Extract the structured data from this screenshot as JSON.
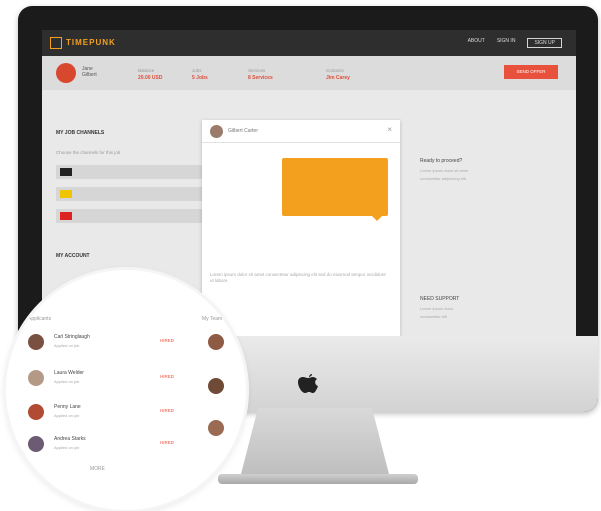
{
  "app": {
    "name": "TIMEPUNK"
  },
  "nav": {
    "item1": "ABOUT",
    "item2": "SIGN IN",
    "item3": "SIGN UP"
  },
  "profile": {
    "name_line1": "Jane",
    "name_line2": "Gilbert",
    "stats": [
      {
        "label": "Balance",
        "value": "20.00 USD"
      },
      {
        "label": "Jobs",
        "value": "5 Jobs"
      },
      {
        "label": "Services",
        "value": "8 Services"
      },
      {
        "label": "Contacts",
        "value": "Jim Carey"
      }
    ],
    "cta_label": "SEND OFFER"
  },
  "left": {
    "title": "MY JOB CHANNELS",
    "subtitle": "Choose the channels for this job",
    "section2": "MY ACCOUNT"
  },
  "modal": {
    "sender": "Gilbert Carter",
    "close": "×",
    "footer_text": "Lorem ipsum dolor sit amet consectetur adipiscing elit sed do eiusmod tempor incididunt ut labore"
  },
  "right": {
    "title": "Ready to proceed?",
    "line1": "Lorem ipsum dolor sit amet",
    "line2": "consectetur adipiscing elit",
    "support_title": "NEED SUPPORT",
    "support_line1": "Lorem ipsum dolor",
    "support_line2": "consectetur elit"
  },
  "magnifier": {
    "header_left": "Applicants",
    "header_right": "My Team",
    "rows": [
      {
        "name": "Carl Stringlaugh",
        "status": "Applied on job",
        "tag": "HIRED"
      },
      {
        "name": "Laura Welder",
        "status": "Applied on job",
        "tag": "HIRED"
      },
      {
        "name": "Penny Lane",
        "status": "Applied on job",
        "tag": "HIRED"
      },
      {
        "name": "Andrea Starks",
        "status": "Applied on job",
        "tag": "HIRED"
      }
    ],
    "more": "MORE"
  }
}
